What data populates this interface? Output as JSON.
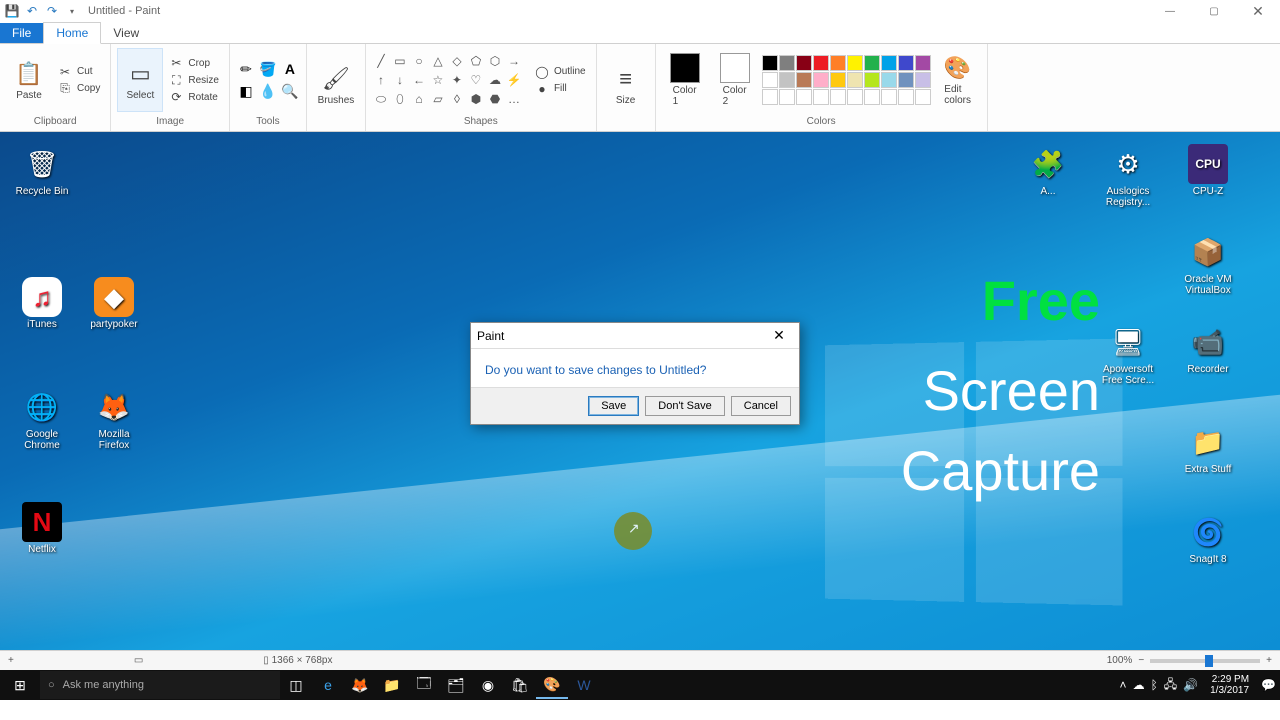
{
  "window": {
    "title": "Untitled - Paint"
  },
  "tabs": {
    "file": "File",
    "home": "Home",
    "view": "View"
  },
  "ribbon": {
    "clipboard": {
      "label": "Clipboard",
      "paste": "Paste",
      "cut": "Cut",
      "copy": "Copy"
    },
    "image": {
      "label": "Image",
      "select": "Select",
      "crop": "Crop",
      "resize": "Resize",
      "rotate": "Rotate"
    },
    "tools": {
      "label": "Tools"
    },
    "brushes": {
      "label": "Brushes",
      "btn": "Brushes"
    },
    "shapes": {
      "label": "Shapes",
      "outline": "Outline",
      "fill": "Fill"
    },
    "size": {
      "label": "Size",
      "btn": "Size"
    },
    "colors": {
      "label": "Colors",
      "c1": "Color\n1",
      "c2": "Color\n2",
      "edit": "Edit\ncolors"
    }
  },
  "dialog": {
    "title": "Paint",
    "message": "Do you want to save changes to Untitled?",
    "save": "Save",
    "dontsave": "Don't Save",
    "cancel": "Cancel"
  },
  "overlay": {
    "l1": "Free",
    "l2": "Screen",
    "l3": "Capture"
  },
  "desktop": {
    "recycle": "Recycle Bin",
    "itunes": "iTunes",
    "partypoker": "partypoker",
    "chrome": "Google Chrome",
    "firefox": "Mozilla Firefox",
    "netflix": "Netflix",
    "auslogics": "Auslogics Registry...",
    "cpuz": "CPU-Z",
    "virtualbox": "Oracle VM VirtualBox",
    "recorder": "Recorder",
    "apowersoft": "Apowersoft Free Scre...",
    "extrastuff": "Extra Stuff",
    "snagit": "SnagIt 8",
    "anonymous": "A..."
  },
  "status": {
    "coords": "+",
    "dim": "1366 × 768px",
    "zoom": "100%"
  },
  "taskbar": {
    "search": "Ask me anything",
    "time": "2:29 PM",
    "date": "1/3/2017"
  },
  "palette": [
    "#000",
    "#7f7f7f",
    "#880015",
    "#ed1c24",
    "#ff7f27",
    "#fff200",
    "#22b14c",
    "#00a2e8",
    "#3f48cc",
    "#a349a4",
    "#fff",
    "#c3c3c3",
    "#b97a57",
    "#ffaec9",
    "#ffc90e",
    "#efe4b0",
    "#b5e61d",
    "#99d9ea",
    "#7092be",
    "#c8bfe7",
    "#fff",
    "#fff",
    "#fff",
    "#fff",
    "#fff",
    "#fff",
    "#fff",
    "#fff",
    "#fff",
    "#fff"
  ]
}
